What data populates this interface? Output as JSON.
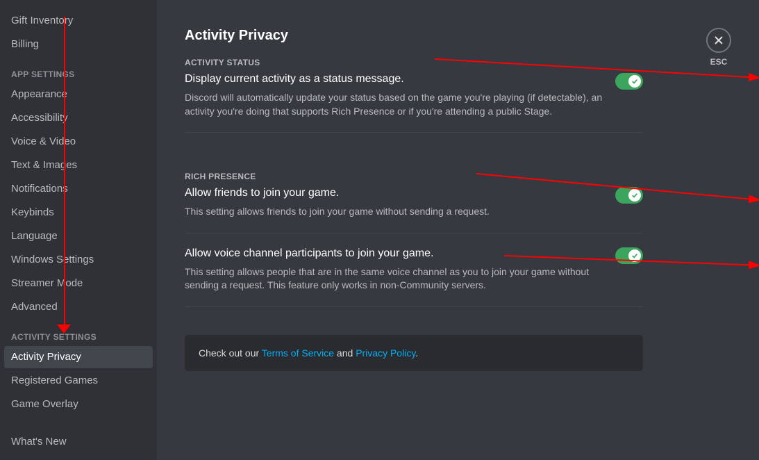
{
  "sidebar": {
    "top_items": [
      {
        "label": "Gift Inventory"
      },
      {
        "label": "Billing"
      }
    ],
    "sections": [
      {
        "header": "APP SETTINGS",
        "items": [
          {
            "label": "Appearance"
          },
          {
            "label": "Accessibility"
          },
          {
            "label": "Voice & Video"
          },
          {
            "label": "Text & Images"
          },
          {
            "label": "Notifications"
          },
          {
            "label": "Keybinds"
          },
          {
            "label": "Language"
          },
          {
            "label": "Windows Settings"
          },
          {
            "label": "Streamer Mode"
          },
          {
            "label": "Advanced"
          }
        ]
      },
      {
        "header": "ACTIVITY SETTINGS",
        "items": [
          {
            "label": "Activity Privacy",
            "selected": true
          },
          {
            "label": "Registered Games"
          },
          {
            "label": "Game Overlay"
          }
        ]
      }
    ],
    "bottom_items": [
      {
        "label": "What's New"
      }
    ]
  },
  "main": {
    "title": "Activity Privacy",
    "close_label": "ESC",
    "sections": [
      {
        "label": "ACTIVITY STATUS",
        "settings": [
          {
            "title": "Display current activity as a status message.",
            "description": "Discord will automatically update your status based on the game you're playing (if detectable), an activity you're doing that supports Rich Presence or if you're attending a public Stage.",
            "enabled": true
          }
        ]
      },
      {
        "label": "RICH PRESENCE",
        "settings": [
          {
            "title": "Allow friends to join your game.",
            "description": "This setting allows friends to join your game without sending a request.",
            "enabled": true
          },
          {
            "title": "Allow voice channel participants to join your game.",
            "description": "This setting allows people that are in the same voice channel as you to join your game without sending a request. This feature only works in non-Community servers.",
            "enabled": true
          }
        ]
      }
    ],
    "notice": {
      "prefix": "Check out our ",
      "tos": "Terms of Service",
      "and": " and ",
      "privacy": "Privacy Policy",
      "suffix": "."
    }
  }
}
